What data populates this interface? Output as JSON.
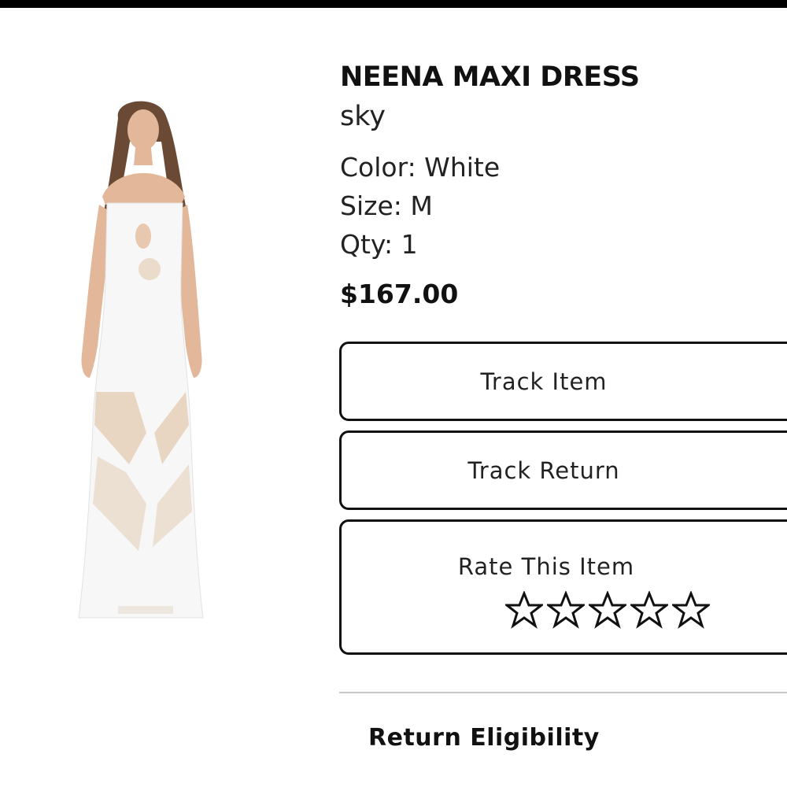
{
  "product": {
    "title": "NEENA MAXI DRESS",
    "brand": "sky",
    "color_line": "Color: White",
    "size_line": "Size: M",
    "qty_line": "Qty: 1",
    "price": "$167.00",
    "image_icon": "dress-model-image"
  },
  "actions": {
    "track_item": "Track Item",
    "track_return": "Track Return",
    "rate_label": "Rate This Item",
    "rating": 0,
    "max_rating": 5,
    "star_icon": "star-outline-icon"
  },
  "sections": {
    "return_eligibility": "Return Eligibility"
  },
  "colors": {
    "top_bar": "#000000",
    "border": "#111111",
    "divider": "#c8c8c8"
  }
}
